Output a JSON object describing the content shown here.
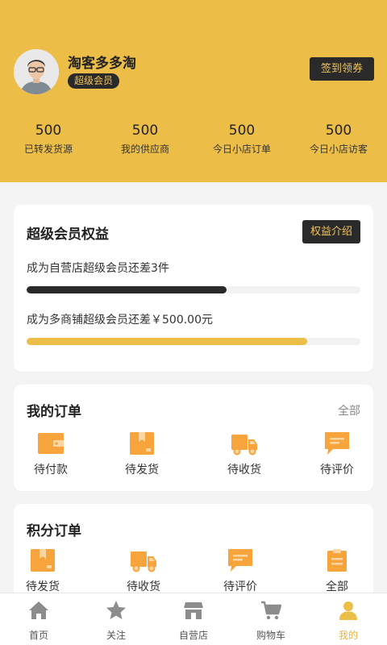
{
  "profile": {
    "name": "淘客多多淘",
    "badge": "超级会员",
    "signin_label": "签到领券"
  },
  "stats": [
    {
      "value": "500",
      "label": "已转发货源"
    },
    {
      "value": "500",
      "label": "我的供应商"
    },
    {
      "value": "500",
      "label": "今日小店订单"
    },
    {
      "value": "500",
      "label": "今日小店访客"
    }
  ],
  "benefits": {
    "title": "超级会员权益",
    "intro_label": "权益介绍",
    "progress1": {
      "text": "成为自营店超级会员还差3件",
      "fraction": 0.6
    },
    "progress2": {
      "text": "成为多商铺超级会员还差￥500.00元",
      "fraction": 0.84
    }
  },
  "orders": {
    "title": "我的订单",
    "all_label": "全部",
    "items": [
      {
        "label": "待付款",
        "icon": "wallet-icon"
      },
      {
        "label": "待发货",
        "icon": "package-icon"
      },
      {
        "label": "待收货",
        "icon": "truck-icon"
      },
      {
        "label": "待评价",
        "icon": "comment-icon"
      }
    ]
  },
  "points_orders": {
    "title": "积分订单",
    "items": [
      {
        "label": "待发货",
        "icon": "package-icon"
      },
      {
        "label": "待收货",
        "icon": "truck-icon"
      },
      {
        "label": "待评价",
        "icon": "comment-icon"
      },
      {
        "label": "全部",
        "icon": "clipboard-icon"
      }
    ]
  },
  "tabbar": [
    {
      "label": "首页",
      "icon": "home-icon"
    },
    {
      "label": "关注",
      "icon": "star-icon"
    },
    {
      "label": "自营店",
      "icon": "store-icon"
    },
    {
      "label": "购物车",
      "icon": "cart-icon"
    },
    {
      "label": "我的",
      "icon": "user-icon",
      "active": true
    }
  ],
  "colors": {
    "brand": "#ecbd47",
    "icon_orange": "#f7a43d",
    "dark": "#2a2a2a",
    "badge_text": "#f0c35a",
    "active_tab": "#e8b33a"
  }
}
